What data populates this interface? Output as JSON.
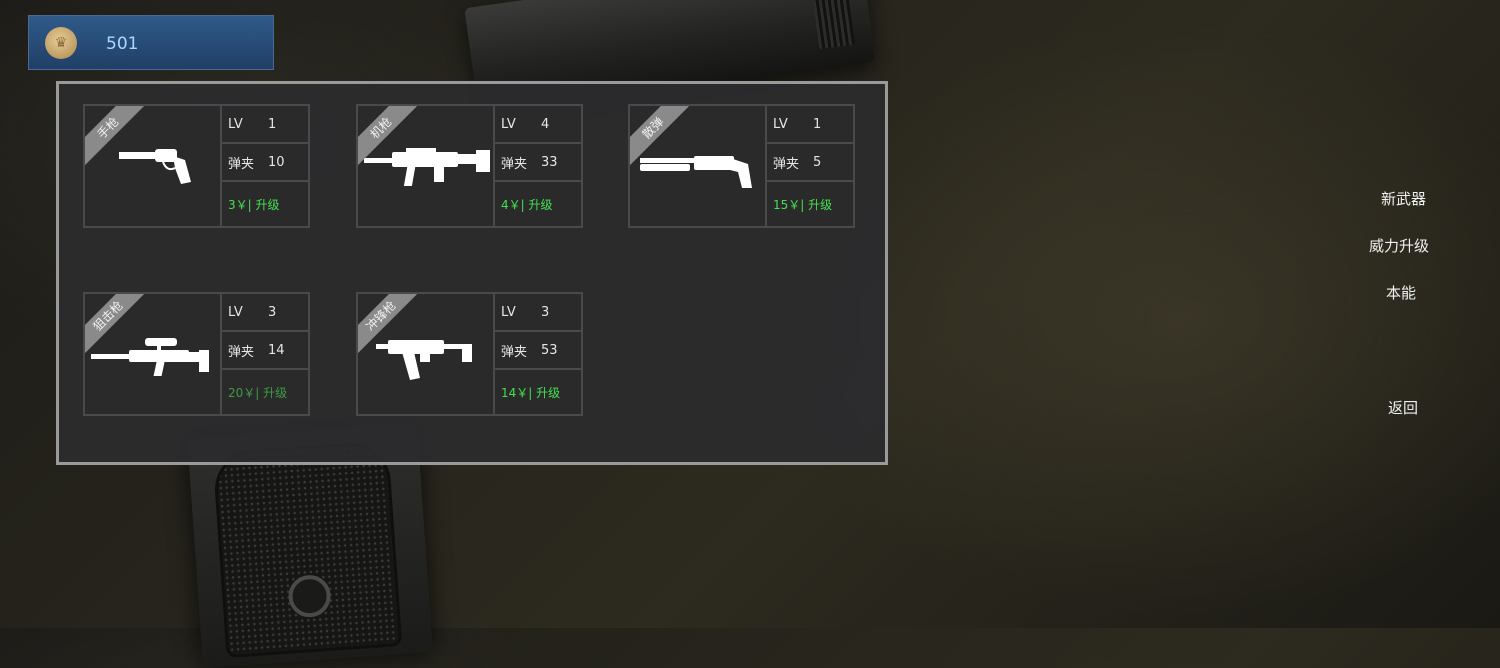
{
  "currency": {
    "icon": "crown-coin-icon",
    "value": "501"
  },
  "weapons": [
    {
      "category": "手枪",
      "icon": "revolver-icon",
      "lv_label": "LV",
      "lv": "1",
      "ammo_label": "弹夹",
      "ammo": "10",
      "upgrade_label": "3￥| 升级"
    },
    {
      "category": "机枪",
      "icon": "assault-rifle-icon",
      "lv_label": "LV",
      "lv": "4",
      "ammo_label": "弹夹",
      "ammo": "33",
      "upgrade_label": "4￥| 升级"
    },
    {
      "category": "散弹",
      "icon": "shotgun-icon",
      "lv_label": "LV",
      "lv": "1",
      "ammo_label": "弹夹",
      "ammo": "5",
      "upgrade_label": "15￥| 升级"
    },
    {
      "category": "狙击枪",
      "icon": "sniper-rifle-icon",
      "lv_label": "LV",
      "lv": "3",
      "ammo_label": "弹夹",
      "ammo": "14",
      "upgrade_label": "20￥| 升级"
    },
    {
      "category": "冲锋枪",
      "icon": "submachine-gun-icon",
      "lv_label": "LV",
      "lv": "3",
      "ammo_label": "弹夹",
      "ammo": "53",
      "upgrade_label": "14￥| 升级"
    }
  ],
  "menu": {
    "new_weapon": "新武器",
    "power_upgrade": "威力升级",
    "instinct": "本能",
    "back": "返回"
  },
  "colors": {
    "currency_bar": "#2a4f7c",
    "upgrade_text": "#44e050",
    "panel_border": "#9a9a9a"
  }
}
